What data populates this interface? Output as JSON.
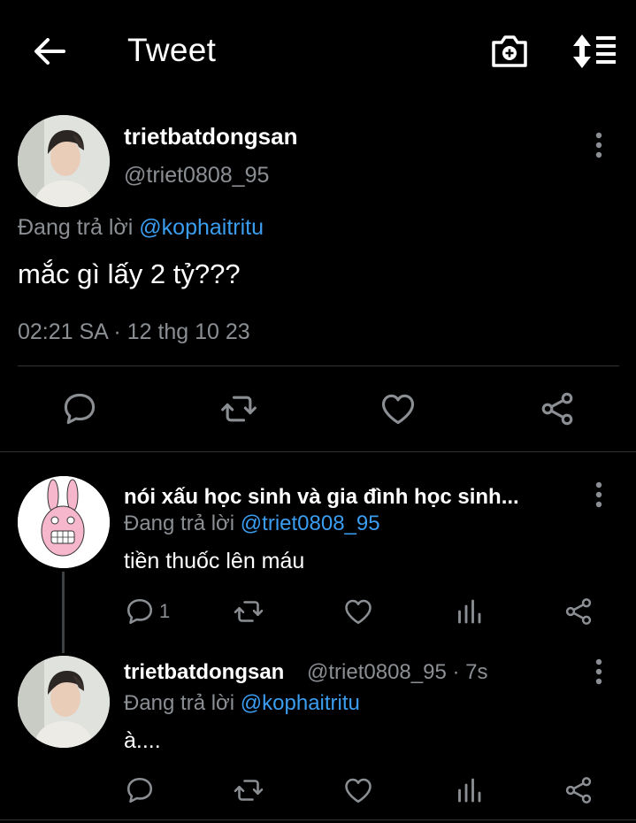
{
  "header": {
    "title": "Tweet",
    "icons": {
      "back": "arrow-left-icon",
      "camera": "camera-plus-icon",
      "sort": "sort-list-icon"
    }
  },
  "main_tweet": {
    "display_name": "trietbatdongsan",
    "handle": "@triet0808_95",
    "reply_prefix": "Đang trả lời",
    "reply_to": "@kophaitritu",
    "text": "mắc gì lấy 2 tỷ???",
    "timestamp": "02:21 SA · 12 thg 10 23"
  },
  "replies": [
    {
      "display_name": "nói xấu học sinh và gia đình học sinh...",
      "reply_prefix": "Đang trả lời",
      "reply_to": "@triet0808_95",
      "text": "tiền thuốc lên máu",
      "reply_count": "1"
    },
    {
      "display_name": "trietbatdongsan",
      "meta": "@triet0808_95 · 7s",
      "reply_prefix": "Đang trả lời",
      "reply_to": "@kophaitritu",
      "text": "à...."
    }
  ],
  "colors": {
    "background": "#000000",
    "text": "#e7e9ea",
    "muted": "#8b8f94",
    "link": "#3b9df0",
    "divider": "#2f3336"
  }
}
